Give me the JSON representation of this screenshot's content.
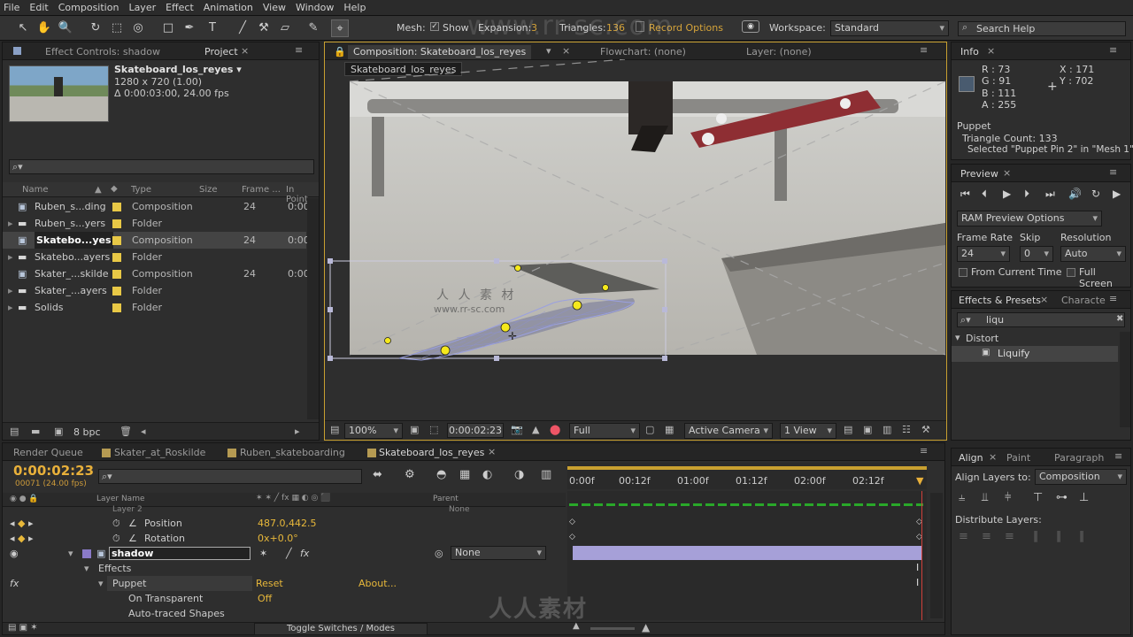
{
  "menu": [
    "File",
    "Edit",
    "Composition",
    "Layer",
    "Effect",
    "Animation",
    "View",
    "Window",
    "Help"
  ],
  "toolbar": {
    "mesh_label": "Mesh:",
    "show_label": "Show",
    "expansion_label": "Expansion:",
    "expansion_value": "3",
    "triangles_label": "Triangles:",
    "triangles_value": "136",
    "record_label": "Record Options",
    "workspace_label": "Workspace:",
    "workspace_value": "Standard",
    "search_placeholder": "Search Help"
  },
  "project": {
    "tabs": [
      "Effect Controls: shadow",
      "Project"
    ],
    "comp_name": "Skateboard_los_reyes ▾",
    "comp_size": "1280 x 720 (1.00)",
    "comp_dur": "Δ 0:00:03:00, 24.00 fps",
    "columns": [
      "Name",
      "Type",
      "Size",
      "Frame ...",
      "In Point"
    ],
    "items": [
      {
        "name": "Ruben_s...ding",
        "type": "Composition",
        "frame": "24",
        "in": "0:00"
      },
      {
        "name": "Ruben_s...yers",
        "type": "Folder",
        "frame": "",
        "in": ""
      },
      {
        "name": "Skatebo...yes",
        "type": "Composition",
        "frame": "24",
        "in": "0:00"
      },
      {
        "name": "Skatebo...ayers",
        "type": "Folder",
        "frame": "",
        "in": ""
      },
      {
        "name": "Skater_...skilde",
        "type": "Composition",
        "frame": "24",
        "in": "0:00"
      },
      {
        "name": "Skater_...ayers",
        "type": "Folder",
        "frame": "",
        "in": ""
      },
      {
        "name": "Solids",
        "type": "Folder",
        "frame": "",
        "in": ""
      }
    ],
    "bpc": "8 bpc"
  },
  "comp": {
    "tabs": [
      "Composition: Skateboard_los_reyes",
      "Flowchart: (none)",
      "Layer: (none)"
    ],
    "crumb": "Skateboard_los_reyes",
    "zoom": "100%",
    "time": "0:00:02:23",
    "quality": "Full",
    "camera": "Active Camera",
    "views": "1 View",
    "watermark1": "人 人 素 材",
    "watermark2": "www.rr-sc.com"
  },
  "info": {
    "title": "Info",
    "r": "R : 73",
    "g": "G : 91",
    "b": "B : 111",
    "a": "A : 255",
    "x": "X : 171",
    "y": "Y : 702",
    "puppet": "Puppet",
    "tri": "Triangle Count: 133",
    "sel": "Selected \"Puppet Pin 2\" in \"Mesh 1\"",
    "swatch": "#495b6f"
  },
  "preview": {
    "title": "Preview",
    "ram": "RAM Preview Options",
    "fr_label": "Frame Rate",
    "skip_label": "Skip",
    "res_label": "Resolution",
    "fr": "24",
    "skip": "0",
    "res": "Auto",
    "from_current": "From Current Time",
    "full_screen": "Full Screen"
  },
  "effects": {
    "tabs": [
      "Effects & Presets",
      "Characte"
    ],
    "search": "liqu",
    "category": "Distort",
    "item": "Liquify"
  },
  "timeline": {
    "tabs": [
      "Render Queue",
      "Skater_at_Roskilde",
      "Ruben_skateboarding",
      "Skateboard_los_reyes"
    ],
    "timecode": "0:00:02:23",
    "frames": "00071 (24.00 fps)",
    "layer_col": "Layer Name",
    "parent_col": "Parent",
    "ruler": [
      "0:00f",
      "00:12f",
      "01:00f",
      "01:12f",
      "02:00f",
      "02:12f"
    ],
    "pos_label": "Position",
    "pos_val": "487.0,442.5",
    "rot_label": "Rotation",
    "rot_val": "0x+0.0°",
    "layer": "shadow",
    "parent": "None",
    "parent_top": "None",
    "layer_top": "Layer 2",
    "effects": "Effects",
    "puppet": "Puppet",
    "reset": "Reset",
    "about": "About...",
    "on_transparent": "On Transparent",
    "off": "Off",
    "auto_traced": "Auto-traced Shapes",
    "toggle": "Toggle Switches / Modes"
  },
  "align": {
    "tabs": [
      "Align",
      "Paint",
      "Paragraph"
    ],
    "align_to_label": "Align Layers to:",
    "align_to": "Composition",
    "distribute": "Distribute Layers:"
  },
  "watermark": "www.rr-sc.com",
  "watermark_bottom": "人人素材"
}
